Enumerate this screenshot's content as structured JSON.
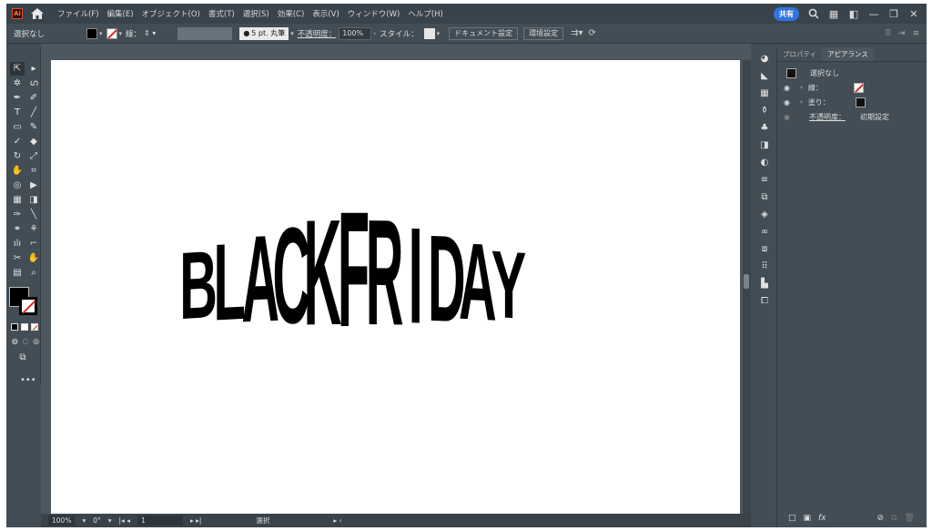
{
  "app": {
    "logo": "Ai"
  },
  "menubar": {
    "items": [
      "ファイル(F)",
      "編集(E)",
      "オブジェクト(O)",
      "書式(T)",
      "選択(S)",
      "効果(C)",
      "表示(V)",
      "ウィンドウ(W)",
      "ヘルプ(H)"
    ],
    "share_label": "共有"
  },
  "controlbar": {
    "selection": "選択なし",
    "stroke_label": "線：",
    "stroke_preset": "5 pt. 丸筆",
    "opacity_label": "不透明度：",
    "opacity_value": "100%",
    "style_label": "スタイル：",
    "doc_settings": "ドキュメント設定",
    "preferences": "環境設定"
  },
  "artwork": {
    "text": "BLACKFRIDAY",
    "letters": [
      "B",
      "L",
      "A",
      "C",
      "K",
      "F",
      "R",
      "I",
      "D",
      "A",
      "Y"
    ],
    "color": "#000000"
  },
  "panel": {
    "tabs": [
      "プロパティ",
      "アピアランス"
    ],
    "active_tab": "アピアランス",
    "header": "選択なし",
    "stroke": "線：",
    "fill": "塗り：",
    "opacity": "不透明度：",
    "opacity_value": "初期設定"
  },
  "statusbar": {
    "zoom": "100%",
    "rotation": "0°",
    "artboard": "1",
    "mode": "選択"
  },
  "colors": {
    "ui_bg": "#424d55",
    "menubar_bg": "#39434b",
    "share_blue": "#2f73e0",
    "stroke_none_red": "#e0261f"
  }
}
